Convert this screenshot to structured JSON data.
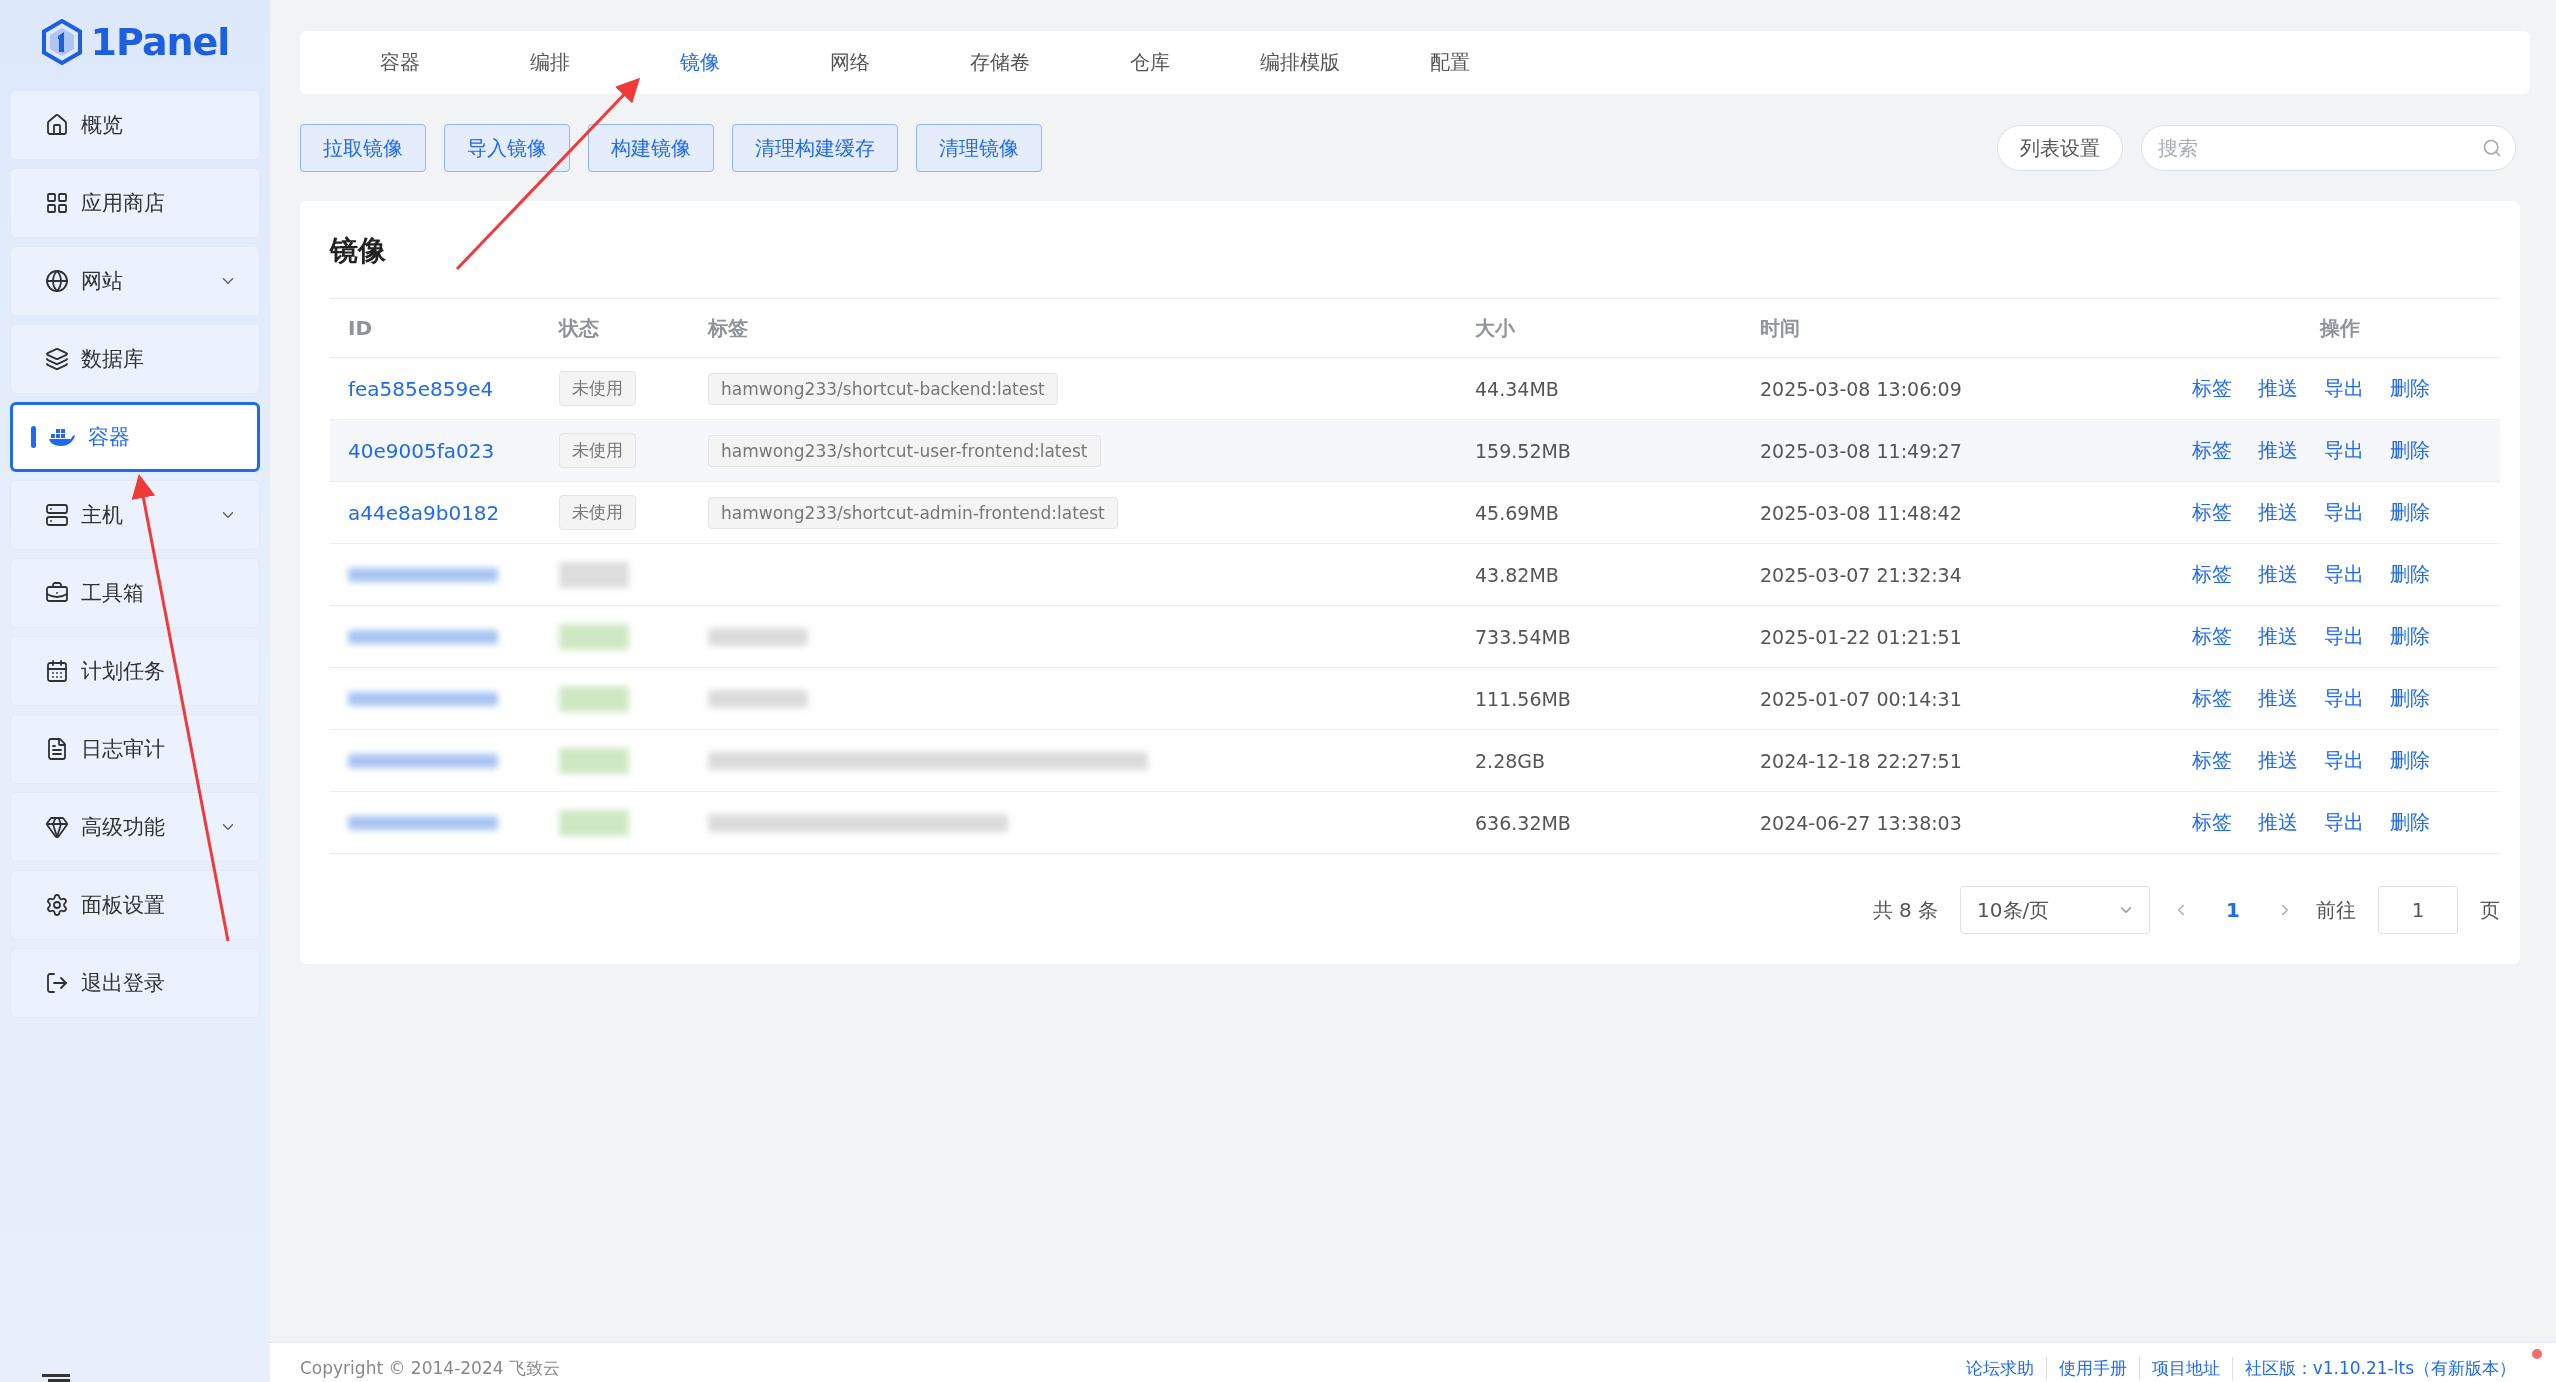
{
  "logo": {
    "text": "1Panel"
  },
  "sidebar": {
    "items": [
      {
        "label": "概览",
        "selected": false,
        "expandable": false
      },
      {
        "label": "应用商店",
        "selected": false,
        "expandable": false
      },
      {
        "label": "网站",
        "selected": false,
        "expandable": true
      },
      {
        "label": "数据库",
        "selected": false,
        "expandable": false
      },
      {
        "label": "容器",
        "selected": true,
        "expandable": false
      },
      {
        "label": "主机",
        "selected": false,
        "expandable": true
      },
      {
        "label": "工具箱",
        "selected": false,
        "expandable": false
      },
      {
        "label": "计划任务",
        "selected": false,
        "expandable": false
      },
      {
        "label": "日志审计",
        "selected": false,
        "expandable": false
      },
      {
        "label": "高级功能",
        "selected": false,
        "expandable": true
      },
      {
        "label": "面板设置",
        "selected": false,
        "expandable": false
      },
      {
        "label": "退出登录",
        "selected": false,
        "expandable": false
      }
    ]
  },
  "tabs": [
    {
      "label": "容器",
      "selected": false
    },
    {
      "label": "编排",
      "selected": false
    },
    {
      "label": "镜像",
      "selected": true
    },
    {
      "label": "网络",
      "selected": false
    },
    {
      "label": "存储卷",
      "selected": false
    },
    {
      "label": "仓库",
      "selected": false
    },
    {
      "label": "编排模版",
      "selected": false
    },
    {
      "label": "配置",
      "selected": false
    }
  ],
  "toolbar": {
    "buttons": [
      "拉取镜像",
      "导入镜像",
      "构建镜像",
      "清理构建缓存",
      "清理镜像"
    ],
    "list_settings": "列表设置",
    "search": {
      "placeholder": "搜索"
    }
  },
  "card": {
    "title": "镜像",
    "table": {
      "columns": [
        "ID",
        "状态",
        "标签",
        "大小",
        "时间",
        "操作"
      ],
      "rows": [
        {
          "id": "fea585e859e4",
          "status": "未使用",
          "tag": "hamwong233/shortcut-backend:latest",
          "size": "44.34MB",
          "time": "2025-03-08 13:06:09",
          "redacted": false,
          "highlighted": false,
          "actions": [
            "标签",
            "推送",
            "导出",
            "删除"
          ]
        },
        {
          "id": "40e9005fa023",
          "status": "未使用",
          "tag": "hamwong233/shortcut-user-frontend:latest",
          "size": "159.52MB",
          "time": "2025-03-08 11:49:27",
          "redacted": false,
          "highlighted": true,
          "actions": [
            "标签",
            "推送",
            "导出",
            "删除"
          ]
        },
        {
          "id": "a44e8a9b0182",
          "status": "未使用",
          "tag": "hamwong233/shortcut-admin-frontend:latest",
          "size": "45.69MB",
          "time": "2025-03-08 11:48:42",
          "redacted": false,
          "highlighted": false,
          "actions": [
            "标签",
            "推送",
            "导出",
            "删除"
          ]
        },
        {
          "size": "43.82MB",
          "time": "2025-03-07 21:32:34",
          "redacted": true,
          "highlighted": false,
          "actions": [
            "标签",
            "推送",
            "导出",
            "删除"
          ]
        },
        {
          "size": "733.54MB",
          "time": "2025-01-22 01:21:51",
          "redacted": true,
          "highlighted": false,
          "actions": [
            "标签",
            "推送",
            "导出",
            "删除"
          ]
        },
        {
          "size": "111.56MB",
          "time": "2025-01-07 00:14:31",
          "redacted": true,
          "highlighted": false,
          "actions": [
            "标签",
            "推送",
            "导出",
            "删除"
          ]
        },
        {
          "size": "2.28GB",
          "time": "2024-12-18 22:27:51",
          "redacted": true,
          "highlighted": false,
          "actions": [
            "标签",
            "推送",
            "导出",
            "删除"
          ]
        },
        {
          "size": "636.32MB",
          "time": "2024-06-27 13:38:03",
          "redacted": true,
          "highlighted": false,
          "actions": [
            "标签",
            "推送",
            "导出",
            "删除"
          ]
        }
      ]
    },
    "pagination": {
      "total": "共 8 条",
      "page_size": "10条/页",
      "pages": [
        {
          "label": "1",
          "selected": true
        }
      ],
      "goto_label": "前往",
      "goto_value": "1",
      "page_suffix": "页"
    }
  },
  "footer": {
    "copyright": "Copyright © 2014-2024 飞致云",
    "links": [
      "论坛求助",
      "使用手册",
      "项目地址"
    ],
    "version": "社区版：v1.10.21-lts（有新版本）",
    "update_dot": true
  }
}
